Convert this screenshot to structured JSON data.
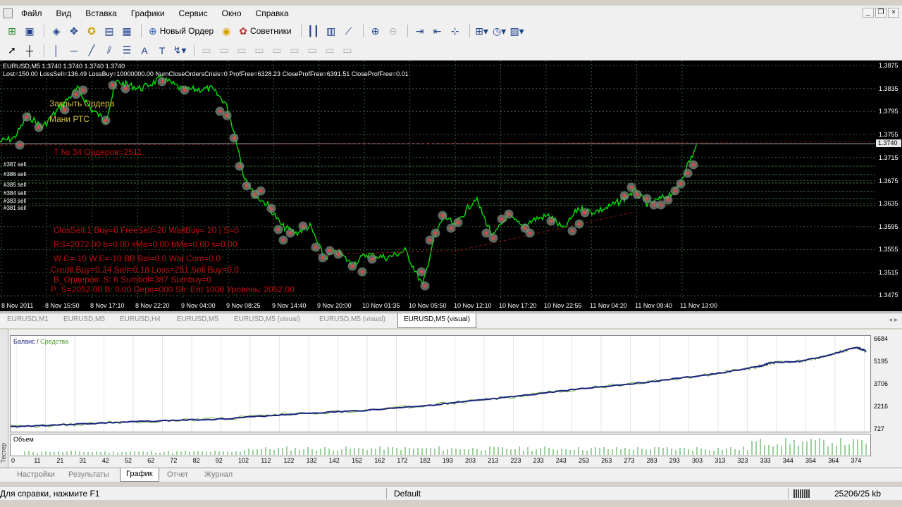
{
  "menu": [
    "Файл",
    "Вид",
    "Вставка",
    "Графики",
    "Сервис",
    "Окно",
    "Справка"
  ],
  "window_controls": [
    "_",
    "❐",
    "×"
  ],
  "toolbar": {
    "new_order": "Новый Ордер",
    "advisors": "Советники"
  },
  "chart": {
    "info_line1": "EURUSD,M5  1.3740 1.3740 1.3740 1.3740",
    "info_line2": "Lost=150.00  LossSell=136.49  LossBuy=10000000.00  NumCloseOrdersCrisis=0  ProfFree=6328.23  CloseProfFree=6391.51  CloseProfFree=0.01",
    "overlays": [
      {
        "text": "Закрыть Ордера",
        "color": "yellow"
      },
      {
        "text": "Мани РТС",
        "color": "yellow"
      },
      {
        "text": "T № 34  Ордеров=2511",
        "color": "red"
      },
      {
        "text": "ClosSell:1 Buy=0 FreeSell=20  WaitBuy= 20 | S=0",
        "color": "red"
      },
      {
        "text": "RS=2072.00  b=0.00  sMa=0.00  bMa=0.00  s=0.00",
        "color": "red"
      },
      {
        "text": "W.C=-10  W.E=-10  BB Bal=0.0  Wat Com=0.0",
        "color": "red"
      },
      {
        "text": "Credit Buy=0.34  Sell=0.18  Loss=251  Sell Buy=0.0",
        "color": "red"
      },
      {
        "text": "B_Ордеров: S: 6  Sumbol=387  Sumbuy=0",
        "color": "red"
      },
      {
        "text": "P_S=2052.00  B: 0.00  Depo=000  Sh: Ent 1000  Уровень: 2052.00",
        "color": "red"
      }
    ],
    "order_labels": [
      "#387 sell",
      "#386 sell",
      "#385 sell",
      "#384 sell",
      "#383 sell",
      "#381 sell"
    ],
    "price_ticks": [
      "1.3875",
      "1.3835",
      "1.3795",
      "1.3755",
      "1.3715",
      "1.3675",
      "1.3635",
      "1.3595",
      "1.3555",
      "1.3515",
      "1.3475"
    ],
    "current_price": "1.3740",
    "time_ticks": [
      "8 Nov 2011",
      "8 Nov 15:50",
      "8 Nov 17:10",
      "8 Nov 22:20",
      "9 Nov 04:00",
      "9 Nov 08:25",
      "9 Nov 14:40",
      "9 Nov 20:00",
      "10 Nov 01:35",
      "10 Nov 05:50",
      "10 Nov 12:10",
      "10 Nov 17:20",
      "10 Nov 22:55",
      "11 Nov 04:20",
      "11 Nov 09:40",
      "11 Nov 13:00"
    ]
  },
  "chart_tabs": [
    "EURUSD,M1",
    "EURUSD,M5",
    "EURUSD,H4",
    "EURUSD,M5",
    "EURUSD,M5 (visual)",
    "EURUSD,M5 (visual)",
    "EURUSD,M5 (visual)"
  ],
  "active_chart_tab": 6,
  "tester": {
    "side_label": "Тестер",
    "balance_label": "Баланс",
    "equity_label": "Средства",
    "volume_label": "Объем",
    "y_ticks": [
      "6684",
      "5195",
      "3706",
      "2216",
      "727"
    ],
    "x_ticks": [
      "0",
      "11",
      "21",
      "31",
      "42",
      "52",
      "62",
      "72",
      "82",
      "92",
      "102",
      "112",
      "122",
      "132",
      "142",
      "152",
      "162",
      "172",
      "182",
      "193",
      "203",
      "213",
      "223",
      "233",
      "243",
      "253",
      "263",
      "273",
      "283",
      "293",
      "303",
      "313",
      "323",
      "333",
      "344",
      "354",
      "364",
      "374"
    ],
    "colors": {
      "balance": "#1a237e",
      "equity": "#6fae3a"
    }
  },
  "tester_tabs": [
    "Настройки",
    "Результаты",
    "График",
    "Отчет",
    "Журнал"
  ],
  "active_tester_tab": 2,
  "status": {
    "help": "Для справки, нажмите F1",
    "profile": "Default",
    "traffic": "25206/25 kb"
  },
  "chart_colors": {
    "price_line": "#00e000",
    "grid": "#3a5a3a",
    "background": "#000000",
    "marker": "#d94848"
  }
}
